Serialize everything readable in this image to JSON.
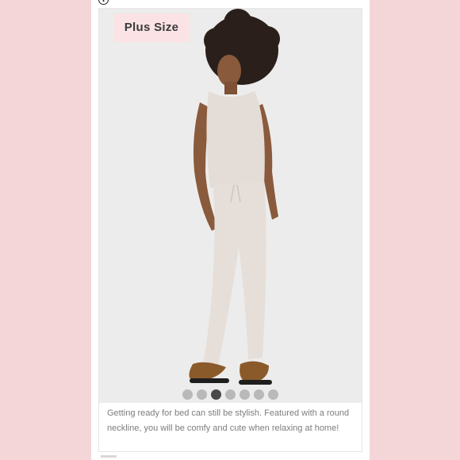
{
  "listing": {
    "badge_label": "Plus Size",
    "description": "Getting ready for bed can still be stylish. Featured with a round neckline, you will be comfy and cute when relaxing at home!",
    "carousel": {
      "total_images": 7,
      "active_index": 3
    }
  },
  "icons": {
    "info": "info-icon"
  },
  "colors": {
    "background": "#f4d5d8",
    "badge_background": "#fbe3e5",
    "dot_inactive": "#b9b9b9",
    "dot_active": "#4a4a4a",
    "description_text": "#7d7d7d"
  }
}
